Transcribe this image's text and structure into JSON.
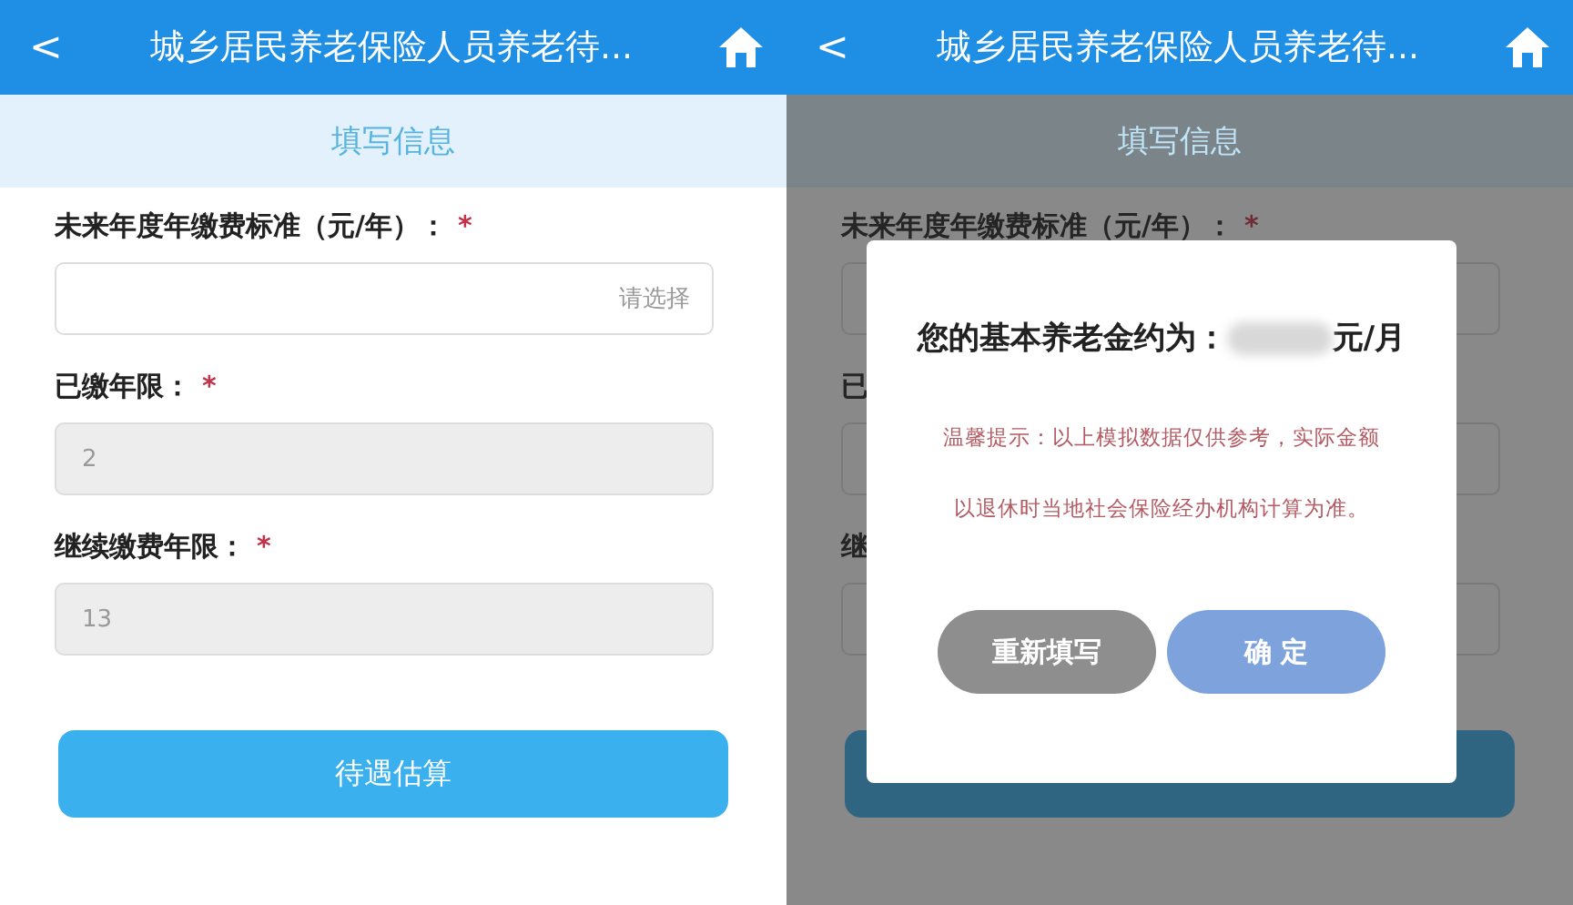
{
  "screens": [
    {
      "header": {
        "back": "<",
        "title": "城乡居民养老保险人员养老待..."
      },
      "section": "填写信息",
      "fields": [
        {
          "label": "未来年度年缴费标准（元/年）：",
          "mark": "*",
          "placeholder": "请选择",
          "disabled": false
        },
        {
          "label": "已缴年限：",
          "mark": "*",
          "value": "2",
          "disabled": true
        },
        {
          "label": "继续缴费年限：",
          "mark": "*",
          "value": "13",
          "disabled": true
        }
      ],
      "button": "待遇估算"
    },
    {
      "header": {
        "back": "<",
        "title": "城乡居民养老保险人员养老待..."
      },
      "section": "填写信息",
      "fields": [
        {
          "label": "未来年度年缴费标准（元/年）：",
          "mark": "*"
        },
        {
          "label": "已"
        },
        {
          "label": "继"
        }
      ],
      "dialog": {
        "title_prefix": "您的基本养老金约为：",
        "title_suffix": "元/月",
        "hint_lines": [
          "温馨提示：以上模拟数据仅供参考，实际金额",
          "以退休时当地社会保险经办机构计算为准。"
        ],
        "buttons": [
          {
            "label": "重新填写",
            "kind": "secondary"
          },
          {
            "label": "确 定",
            "kind": "primary"
          }
        ]
      }
    }
  ]
}
